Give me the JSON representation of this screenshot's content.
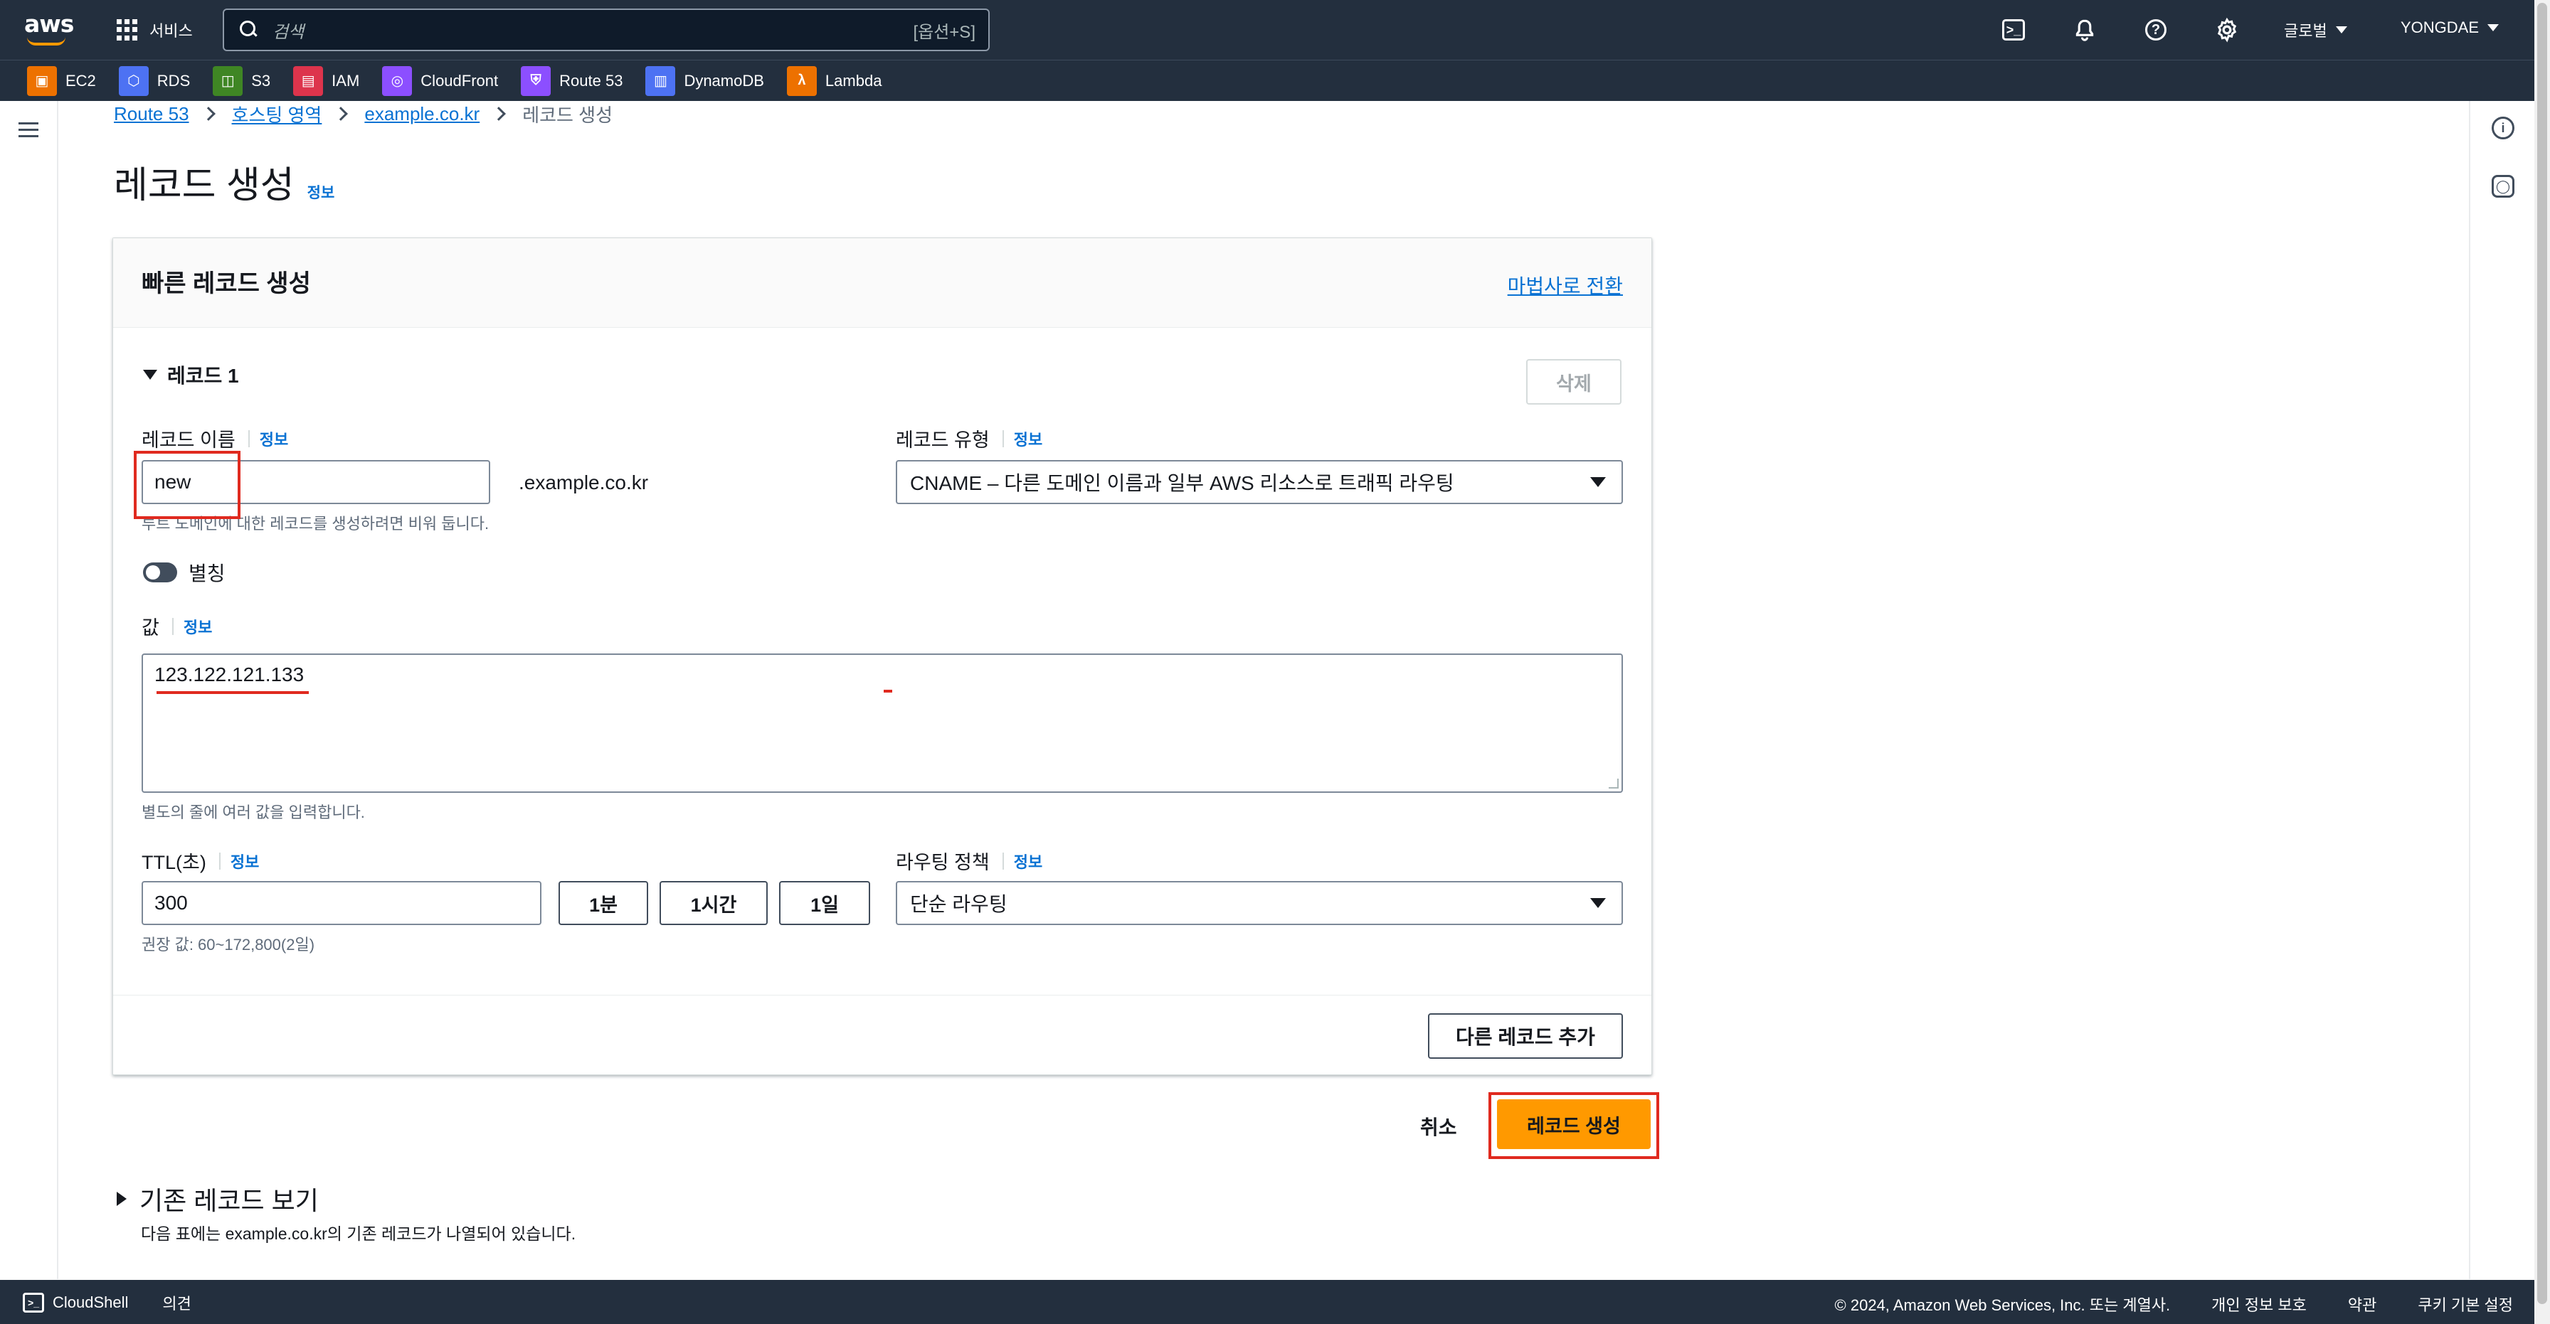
{
  "topnav": {
    "services_label": "서비스",
    "search_placeholder": "검색",
    "search_shortcut": "[옵션+S]",
    "region_label": "글로벌",
    "user_label": "YONGDAE",
    "icons": [
      "cloudshell-icon",
      "bell-icon",
      "help-icon",
      "settings-icon"
    ]
  },
  "favorites": [
    {
      "label": "EC2",
      "color": "#ed7100"
    },
    {
      "label": "RDS",
      "color": "#4d72f3"
    },
    {
      "label": "S3",
      "color": "#3f8624"
    },
    {
      "label": "IAM",
      "color": "#dd344c"
    },
    {
      "label": "CloudFront",
      "color": "#8c4fff"
    },
    {
      "label": "Route 53",
      "color": "#8c4fff"
    },
    {
      "label": "DynamoDB",
      "color": "#4d72f3"
    },
    {
      "label": "Lambda",
      "color": "#ed7100"
    }
  ],
  "breadcrumb": {
    "items": [
      "Route 53",
      "호스팅 영역",
      "example.co.kr"
    ],
    "current": "레코드 생성"
  },
  "page": {
    "title": "레코드 생성",
    "info": "정보"
  },
  "form": {
    "container_title": "빠른 레코드 생성",
    "wizard_link": "마법사로 전환",
    "record_section": "레코드 1",
    "delete_label": "삭제",
    "record_name": {
      "label": "레코드 이름",
      "info": "정보",
      "value": "new",
      "suffix": ".example.co.kr",
      "hint": "루트 도메인에 대한 레코드를 생성하려면 비워 둡니다."
    },
    "record_type": {
      "label": "레코드 유형",
      "info": "정보",
      "value": "CNAME – 다른 도메인 이름과 일부 AWS 리소스로 트래픽 라우팅"
    },
    "alias": {
      "label": "별칭",
      "enabled": false
    },
    "value": {
      "label": "값",
      "info": "정보",
      "value": "123.122.121.133",
      "hint": "별도의 줄에 여러 값을 입력합니다."
    },
    "ttl": {
      "label": "TTL(초)",
      "info": "정보",
      "value": "300",
      "presets": [
        "1분",
        "1시간",
        "1일"
      ],
      "hint": "권장 값: 60~172,800(2일)"
    },
    "routing": {
      "label": "라우팅 정책",
      "info": "정보",
      "value": "단순 라우팅"
    },
    "add_record_label": "다른 레코드 추가"
  },
  "actions": {
    "cancel_label": "취소",
    "create_label": "레코드 생성"
  },
  "existing": {
    "title": "기존 레코드 보기",
    "description": "다음 표에는 example.co.kr의 기존 레코드가 나열되어 있습니다."
  },
  "bottombar": {
    "cloudshell": "CloudShell",
    "feedback": "의견",
    "copyright": "© 2024, Amazon Web Services, Inc. 또는 계열사.",
    "privacy": "개인 정보 보호",
    "terms": "약관",
    "cookies": "쿠키 기본 설정"
  },
  "colors": {
    "header_bg": "#232f3e",
    "primary_button": "#ff9900",
    "link": "#0972d3",
    "annotation": "#e02a1f"
  }
}
